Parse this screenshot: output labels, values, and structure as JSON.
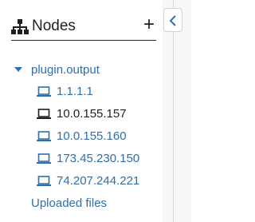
{
  "panel": {
    "title": "Nodes",
    "title_icon": "sitemap-icon",
    "add_label": "+",
    "tree": {
      "root_label": "plugin.output",
      "nodes": [
        {
          "label": "1.1.1.1",
          "icon": "laptop-icon",
          "selected": false
        },
        {
          "label": "10.0.155.157",
          "icon": "laptop-icon",
          "selected": true
        },
        {
          "label": "10.0.155.160",
          "icon": "laptop-icon",
          "selected": false
        },
        {
          "label": "173.45.230.150",
          "icon": "laptop-icon",
          "selected": false
        },
        {
          "label": "74.207.244.221",
          "icon": "laptop-icon",
          "selected": false
        }
      ]
    },
    "uploaded_files_label": "Uploaded files"
  },
  "collapse": {
    "icon": "chevron-left-icon"
  },
  "colors": {
    "link": "#2f6fad",
    "text": "#1f1f1f",
    "strip": "#f7f7f7"
  }
}
